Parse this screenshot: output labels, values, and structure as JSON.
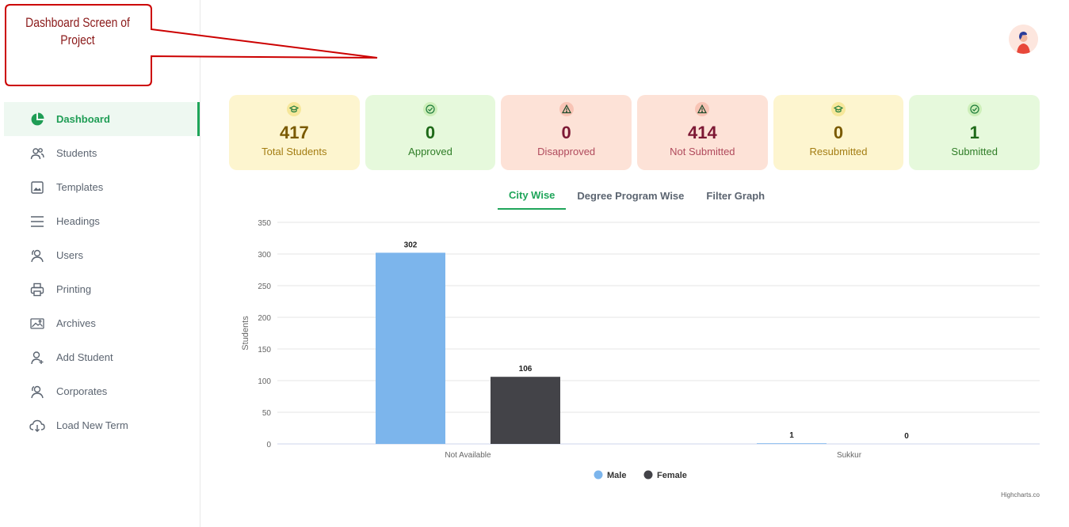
{
  "callout": {
    "line1": "Dashboard Screen of",
    "line2": "Project"
  },
  "sidebar": {
    "items": [
      {
        "label": "Dashboard",
        "icon": "pie-chart-icon",
        "active": true
      },
      {
        "label": "Students",
        "icon": "users-icon"
      },
      {
        "label": "Templates",
        "icon": "image-frame-icon"
      },
      {
        "label": "Headings",
        "icon": "menu-lines-icon"
      },
      {
        "label": "Users",
        "icon": "users-outline-icon"
      },
      {
        "label": "Printing",
        "icon": "printer-icon"
      },
      {
        "label": "Archives",
        "icon": "picture-icon"
      },
      {
        "label": "Add Student",
        "icon": "user-add-icon"
      },
      {
        "label": "Corporates",
        "icon": "users-outline-icon"
      },
      {
        "label": "Load New Term",
        "icon": "cloud-download-icon"
      }
    ]
  },
  "stats": [
    {
      "value": "417",
      "label": "Total Students",
      "icon": "graduation-cap-icon",
      "tone": "yellow"
    },
    {
      "value": "0",
      "label": "Approved",
      "icon": "check-circle-icon",
      "tone": "green"
    },
    {
      "value": "0",
      "label": "Disapproved",
      "icon": "warning-triangle-icon",
      "tone": "red"
    },
    {
      "value": "414",
      "label": "Not Submitted",
      "icon": "warning-triangle-icon",
      "tone": "red"
    },
    {
      "value": "0",
      "label": "Resubmitted",
      "icon": "graduation-cap-icon",
      "tone": "yellow"
    },
    {
      "value": "1",
      "label": "Submitted",
      "icon": "check-circle-icon",
      "tone": "green"
    }
  ],
  "tabs": [
    {
      "label": "City Wise",
      "active": true
    },
    {
      "label": "Degree Program Wise"
    },
    {
      "label": "Filter Graph"
    }
  ],
  "colors": {
    "accent": "#1fa55a",
    "male": "#7cb5ec",
    "female": "#434348"
  },
  "chart_data": {
    "type": "bar",
    "categories": [
      "Not Available",
      "Sukkur"
    ],
    "series": [
      {
        "name": "Male",
        "values": [
          302,
          1
        ],
        "color": "#7cb5ec"
      },
      {
        "name": "Female",
        "values": [
          106,
          0
        ],
        "color": "#434348"
      }
    ],
    "ylabel": "Students",
    "ylim": [
      0,
      350
    ],
    "yticks": [
      "0",
      "50",
      "100",
      "150",
      "200",
      "250",
      "300",
      "350"
    ],
    "grid": true,
    "legend": "bottom-center",
    "credits": "Highcharts.co"
  }
}
